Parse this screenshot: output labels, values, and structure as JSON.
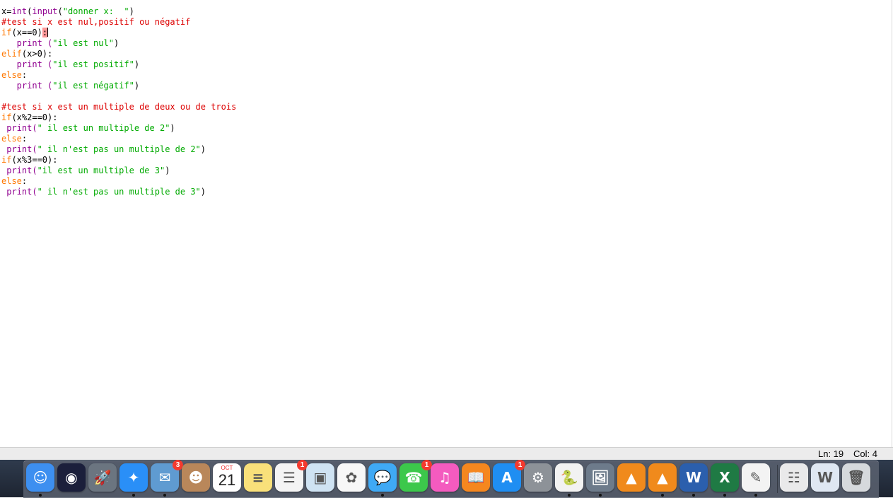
{
  "editor": {
    "lines": [
      [
        {
          "t": "x=",
          "c": "default"
        },
        {
          "t": "int",
          "c": "builtin"
        },
        {
          "t": "(",
          "c": "default"
        },
        {
          "t": "input",
          "c": "builtin"
        },
        {
          "t": "(",
          "c": "default"
        },
        {
          "t": "\"donner x:  \"",
          "c": "string"
        },
        {
          "t": ")",
          "c": "default"
        }
      ],
      [
        {
          "t": "#test si x est nul,positif ou négatif",
          "c": "comment"
        }
      ],
      [
        {
          "t": "if",
          "c": "keyword"
        },
        {
          "t": "(x==0)",
          "c": "default"
        },
        {
          "t": ":",
          "c": "match"
        },
        {
          "t": "",
          "c": "cursor"
        }
      ],
      [
        {
          "t": "   print (",
          "c": "builtin"
        },
        {
          "t": "\"il est nul\"",
          "c": "string"
        },
        {
          "t": ")",
          "c": "default"
        }
      ],
      [
        {
          "t": "elif",
          "c": "keyword"
        },
        {
          "t": "(x>0):",
          "c": "default"
        }
      ],
      [
        {
          "t": "   print (",
          "c": "builtin"
        },
        {
          "t": "\"il est positif\"",
          "c": "string"
        },
        {
          "t": ")",
          "c": "default"
        }
      ],
      [
        {
          "t": "else",
          "c": "keyword"
        },
        {
          "t": ":",
          "c": "default"
        }
      ],
      [
        {
          "t": "   print (",
          "c": "builtin"
        },
        {
          "t": "\"il est négatif\"",
          "c": "string"
        },
        {
          "t": ")",
          "c": "default"
        }
      ],
      [],
      [
        {
          "t": "#test si x est un multiple de deux ou de trois",
          "c": "comment"
        }
      ],
      [
        {
          "t": "if",
          "c": "keyword"
        },
        {
          "t": "(x%2==0):",
          "c": "default"
        }
      ],
      [
        {
          "t": " print(",
          "c": "builtin"
        },
        {
          "t": "\" il est un multiple de 2\"",
          "c": "string"
        },
        {
          "t": ")",
          "c": "default"
        }
      ],
      [
        {
          "t": "else",
          "c": "keyword"
        },
        {
          "t": ":",
          "c": "default"
        }
      ],
      [
        {
          "t": " print(",
          "c": "builtin"
        },
        {
          "t": "\" il n'est pas un multiple de 2\"",
          "c": "string"
        },
        {
          "t": ")",
          "c": "default"
        }
      ],
      [
        {
          "t": "if",
          "c": "keyword"
        },
        {
          "t": "(x%3==0):",
          "c": "default"
        }
      ],
      [
        {
          "t": " print(",
          "c": "builtin"
        },
        {
          "t": "\"il est un multiple de 3\"",
          "c": "string"
        },
        {
          "t": ")",
          "c": "default"
        }
      ],
      [
        {
          "t": "else",
          "c": "keyword"
        },
        {
          "t": ":",
          "c": "default"
        }
      ],
      [
        {
          "t": " print(",
          "c": "builtin"
        },
        {
          "t": "\" il n'est pas un multiple de 3\"",
          "c": "string"
        },
        {
          "t": ")",
          "c": "default"
        }
      ]
    ]
  },
  "status": {
    "line": "Ln: 19",
    "col": "Col: 4"
  },
  "dock": {
    "items": [
      {
        "name": "finder-icon",
        "bg": "#3d8ff0",
        "glyph": "☺",
        "running": true
      },
      {
        "name": "siri-icon",
        "bg": "#1b1f3b",
        "glyph": "◉",
        "running": false
      },
      {
        "name": "launchpad-icon",
        "bg": "#6b7580",
        "glyph": "🚀",
        "running": false
      },
      {
        "name": "safari-icon",
        "bg": "#2a8ff7",
        "glyph": "✦",
        "running": true
      },
      {
        "name": "mail-icon",
        "bg": "#5f9bd1",
        "glyph": "✉",
        "running": true,
        "badge": "3"
      },
      {
        "name": "contacts-icon",
        "bg": "#b9875a",
        "glyph": "☻",
        "running": false
      },
      {
        "name": "calendar-icon",
        "bg": "#ffffff",
        "glyph": "",
        "running": false,
        "calendar": {
          "month": "OCT",
          "day": "21"
        }
      },
      {
        "name": "notes-icon",
        "bg": "#f9e07a",
        "glyph": "≡",
        "running": false
      },
      {
        "name": "reminders-icon",
        "bg": "#f4f4f4",
        "glyph": "☰",
        "running": false,
        "badge": "1"
      },
      {
        "name": "preview-icon",
        "bg": "#cfe3f3",
        "glyph": "▣",
        "running": false
      },
      {
        "name": "photos-icon",
        "bg": "#f7f7f7",
        "glyph": "✿",
        "running": false
      },
      {
        "name": "messages-icon",
        "bg": "#3fa9f5",
        "glyph": "💬",
        "running": true
      },
      {
        "name": "facetime-icon",
        "bg": "#3cc84b",
        "glyph": "☎",
        "running": false,
        "badge": "1"
      },
      {
        "name": "itunes-icon",
        "bg": "#f45bbf",
        "glyph": "♫",
        "running": false
      },
      {
        "name": "ibooks-icon",
        "bg": "#f5871f",
        "glyph": "📖",
        "running": false
      },
      {
        "name": "app-store-icon",
        "bg": "#1f8ef2",
        "glyph": "A",
        "running": false,
        "badge": "1"
      },
      {
        "name": "system-preferences-icon",
        "bg": "#8d9298",
        "glyph": "⚙",
        "running": false
      },
      {
        "name": "python-launcher-icon",
        "bg": "#f2f2f2",
        "glyph": "🐍",
        "running": true
      },
      {
        "name": "image-capture-icon",
        "bg": "#6d7b8b",
        "glyph": "🖼",
        "running": true
      },
      {
        "name": "vlc-icon",
        "bg": "#f08a1c",
        "glyph": "▲",
        "running": false
      },
      {
        "name": "vlc-2-icon",
        "bg": "#f08a1c",
        "glyph": "▲",
        "running": true
      },
      {
        "name": "word-icon",
        "bg": "#2b5fad",
        "glyph": "W",
        "running": true
      },
      {
        "name": "excel-icon",
        "bg": "#1f7a44",
        "glyph": "X",
        "running": true
      },
      {
        "name": "textedit-icon",
        "bg": "#f3f3f3",
        "glyph": "✎",
        "running": true
      },
      {
        "name": "document-stack-icon",
        "bg": "#e9e9ea",
        "glyph": "☷",
        "running": false
      },
      {
        "name": "word-document-icon",
        "bg": "#dfe7f2",
        "glyph": "W",
        "running": false
      },
      {
        "name": "trash-icon",
        "bg": "#d6d9dc",
        "glyph": "🗑",
        "running": false
      }
    ]
  }
}
